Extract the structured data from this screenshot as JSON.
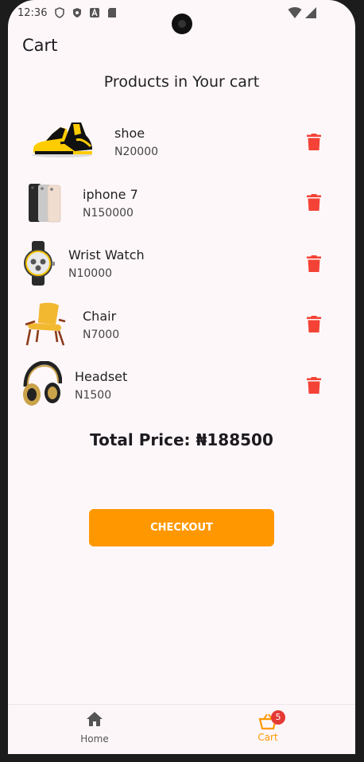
{
  "status_bar": {
    "time": "12:36"
  },
  "app_bar": {
    "title": "Cart"
  },
  "section_title": "Products in Your cart",
  "products": [
    {
      "name": "shoe",
      "price": "N20000",
      "image": "sneaker-image"
    },
    {
      "name": "iphone 7",
      "price": "N150000",
      "image": "iphone-image"
    },
    {
      "name": "Wrist Watch",
      "price": "N10000",
      "image": "watch-image"
    },
    {
      "name": "Chair",
      "price": "N7000",
      "image": "chair-image"
    },
    {
      "name": "Headset",
      "price": "N1500",
      "image": "headset-image"
    }
  ],
  "total_price": "Total Price: ₦188500",
  "checkout_label": "CHECKOUT",
  "bottom_nav": {
    "home_label": "Home",
    "cart_label": "Cart",
    "cart_badge": "5"
  },
  "colors": {
    "accent": "#ff9800",
    "delete": "#f44336",
    "badge": "#e53935",
    "background": "#fef7fa"
  }
}
